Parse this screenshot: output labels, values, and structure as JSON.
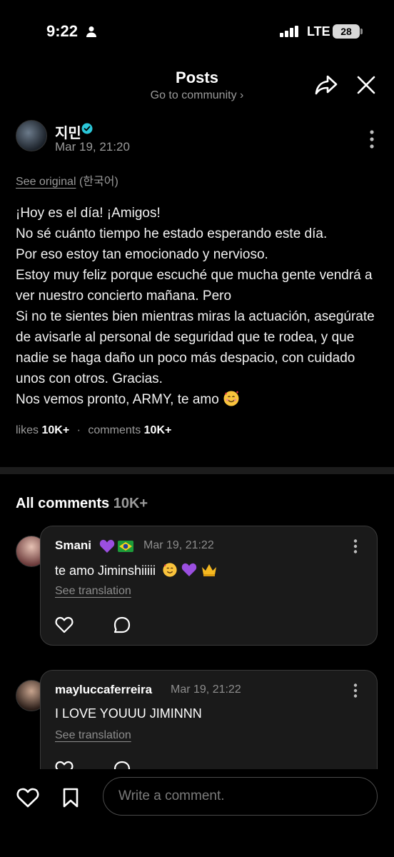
{
  "status_bar": {
    "time": "9:22",
    "network": "LTE",
    "battery": "28"
  },
  "header": {
    "title": "Posts",
    "subtitle": "Go to community ›"
  },
  "post": {
    "author": "지민",
    "date": "Mar 19, 21:20",
    "see_original": "See original",
    "original_language": "(한국어)",
    "body": "¡Hoy es el día! ¡Amigos!\nNo sé cuánto tiempo he estado esperando este día.\nPor eso estoy tan emocionado y nervioso.\nEstoy muy feliz porque escuché que mucha gente vendrá a ver nuestro concierto mañana. Pero\nSi no te sientes bien mientras miras la actuación, asegúrate de avisarle al personal de seguridad que te rodea, y que nadie se haga daño un poco más despacio, con cuidado unos con otros. Gracias.\nNos vemos pronto, ARMY, te amo",
    "likes_label": "likes",
    "likes_count": "10K+",
    "comments_label": "comments",
    "comments_count": "10K+"
  },
  "comments_section": {
    "title": "All comments",
    "count": "10K+",
    "items": [
      {
        "name": "Smani",
        "date": "Mar 19, 21:22",
        "text": "te amo Jiminshiiiii",
        "translate": "See translation"
      },
      {
        "name": "mayluccaferreira",
        "date": "Mar 19, 21:22",
        "text": "I LOVE YOUUU JIMINNN",
        "translate": "See translation"
      }
    ]
  },
  "bottom_bar": {
    "placeholder": "Write a comment."
  },
  "colors": {
    "background": "#000000",
    "verified": "#2bc7d9",
    "muted": "#9a9a9a",
    "bubble": "#1a1a1a"
  }
}
